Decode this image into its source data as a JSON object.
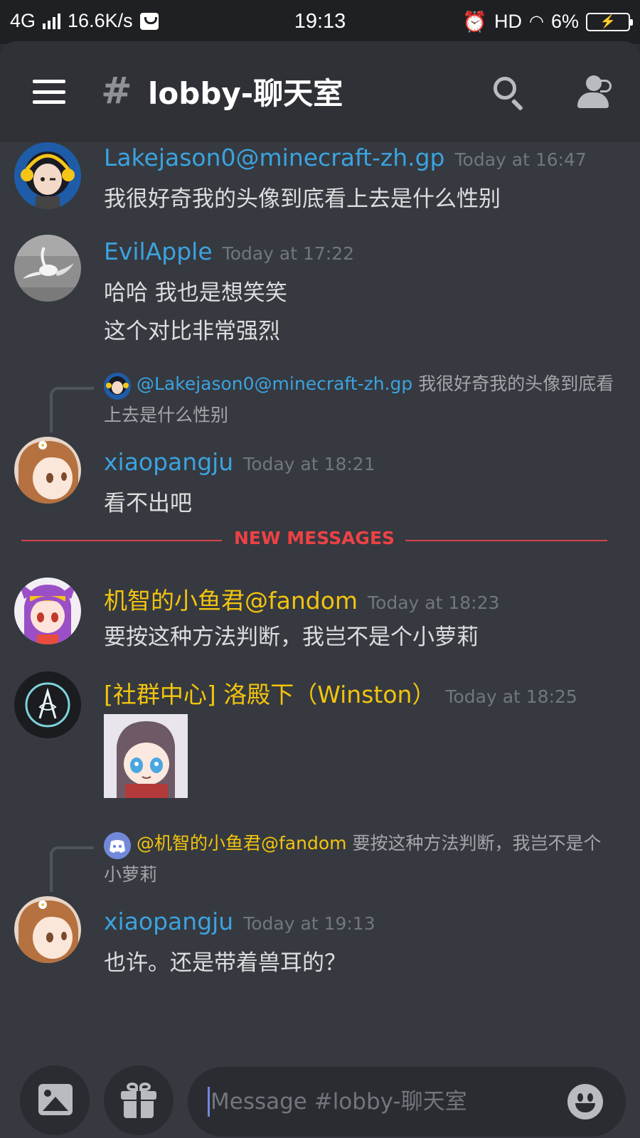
{
  "status_bar": {
    "network": "4G",
    "speed": "16.6K/s",
    "time": "19:13",
    "hd": "HD",
    "battery": "6%"
  },
  "header": {
    "channel_name": "lobby-聊天室",
    "icons": [
      "menu-icon",
      "hash-lock-icon",
      "search-icon",
      "members-icon"
    ]
  },
  "messages": [
    {
      "author": "Lakejason0@minecraft-zh.gp",
      "time": "Today at 16:47",
      "lines": [
        "我很好奇我的头像到底看上去是什么性别"
      ]
    },
    {
      "author": "EvilApple",
      "time": "Today at 17:22",
      "lines": [
        "哈哈 我也是想笑笑",
        "这个对比非常强烈"
      ]
    },
    {
      "reply": {
        "mention": "@Lakejason0@minecraft-zh.gp",
        "text": "我很好奇我的头像到底看上去是什么性别"
      },
      "author": "xiaopangju",
      "time": "Today at 18:21",
      "lines": [
        "看不出吧"
      ]
    },
    {
      "author": "机智的小鱼君@fandom",
      "time": "Today at 18:23",
      "lines": [
        "要按这种方法判断，我岂不是个小萝莉"
      ]
    },
    {
      "author": "[社群中心] 洛殿下（Winston）",
      "time": "Today at 18:25",
      "lines": []
    },
    {
      "reply": {
        "mention": "@机智的小鱼君@fandom",
        "text": "要按这种方法判断，我岂不是个小萝莉"
      },
      "author": "xiaopangju",
      "time": "Today at 19:13",
      "lines": [
        "也许。还是带着兽耳的？"
      ]
    }
  ],
  "divider": {
    "label": "NEW MESSAGES"
  },
  "composer": {
    "placeholder": "Message #lobby-聊天室",
    "icons": [
      "image-icon",
      "gift-icon",
      "emoji-icon"
    ]
  },
  "colors": {
    "background": "#36393f",
    "header": "#2f3136",
    "username_blue": "#3ba3e0",
    "username_gold": "#f1c40f",
    "new_messages_red": "#ed4245",
    "timestamp": "#72767d"
  }
}
